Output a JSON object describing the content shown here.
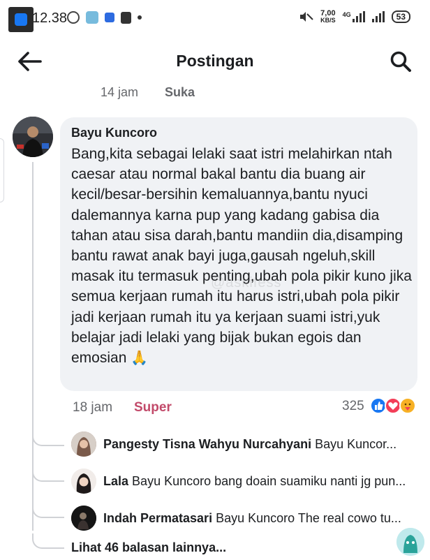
{
  "status_bar": {
    "time": "12.38",
    "net_speed_value": "7,00",
    "net_speed_unit": "KB/S",
    "network_type": "4G",
    "battery": "53"
  },
  "header": {
    "title": "Postingan",
    "back_icon": "arrow-left-icon",
    "search_icon": "search-icon"
  },
  "post_meta": {
    "time": "14 jam",
    "like_label": "Suka"
  },
  "comment": {
    "author": "Bayu Kuncoro",
    "text": "Bang,kita sebagai lelaki saat istri melahirkan ntah caesar atau normal bakal bantu dia buang air kecil/besar-bersihin kemaluannya,bantu nyuci dalemannya karna pup yang kadang gabisa dia tahan atau sisa darah,bantu mandiin dia,disamping bantu rawat anak bayi juga,gausah ngeluh,skill masak itu termasuk penting,ubah pola pikir kuno jika semua kerjaan rumah itu harus istri,ubah pola pikir jadi kerjaan rumah itu ya kerjaan suami istri,yuk belajar jadi lelaki yang bijak bukan egois dan emosian",
    "emoji": "🙏",
    "watermark": "@askifess",
    "time": "18 jam",
    "reaction_label": "Super",
    "reaction_count": "325"
  },
  "replies": [
    {
      "name": "Pangesty Tisna Wahyu Nurcahyani",
      "text": "Bayu Kuncor..."
    },
    {
      "name": "Lala",
      "text": "Bayu Kuncoro bang doain suamiku nanti jg pun..."
    },
    {
      "name": "Indah Permatasari",
      "text": "Bayu Kuncoro The real cowo tu..."
    }
  ],
  "more_replies_label": "Lihat 46 balasan lainnya...",
  "colors": {
    "bubble_bg": "#f0f2f5",
    "super_reaction": "#c24a6a",
    "muted_text": "#65676b",
    "like_blue": "#1877f2",
    "love_red": "#f33e58",
    "care_yellow": "#f7b125"
  }
}
